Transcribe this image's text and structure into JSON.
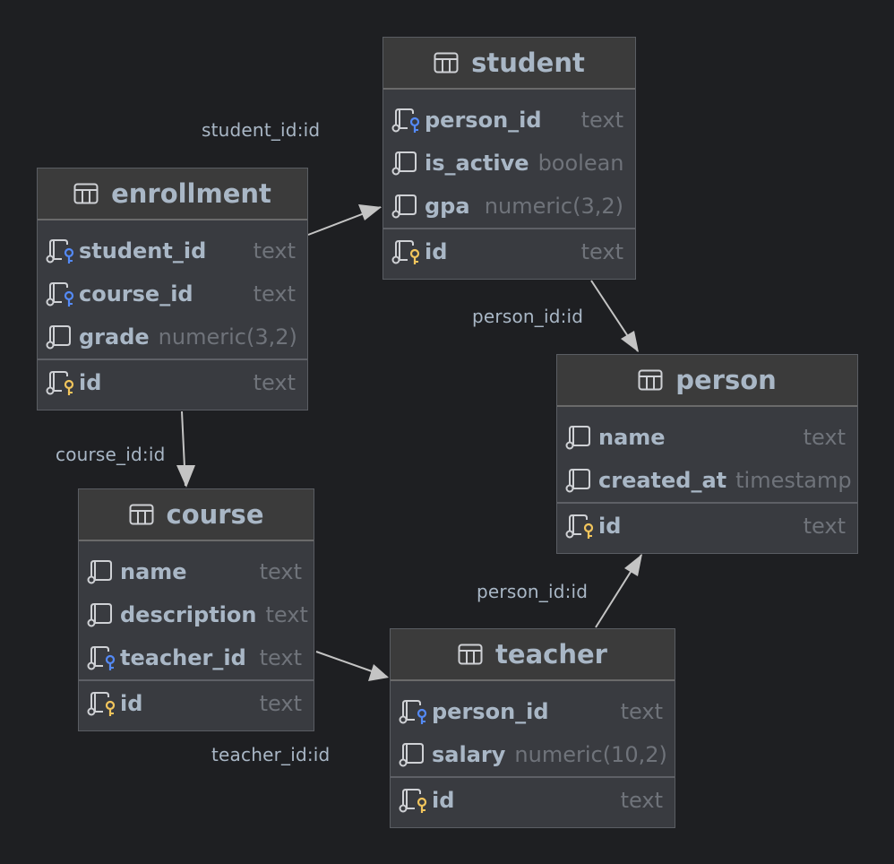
{
  "diagram": {
    "type": "database-er-diagram",
    "colors": {
      "background": "#1e1f22",
      "table_body": "#393b40",
      "table_header": "#3b3b3b",
      "column_name": "#a9b7c6",
      "column_type": "#6f737a",
      "foreign_key": "#548af7",
      "primary_key": "#f2c55c",
      "edge": "#c4c4c4"
    },
    "tables": {
      "student": {
        "name": "student",
        "columns": [
          {
            "name": "person_id",
            "type": "text",
            "key": "foreign"
          },
          {
            "name": "is_active",
            "type": "boolean",
            "key": "none"
          },
          {
            "name": "gpa",
            "type": "numeric(3,2)",
            "key": "none"
          }
        ],
        "primary": [
          {
            "name": "id",
            "type": "text",
            "key": "primary"
          }
        ]
      },
      "enrollment": {
        "name": "enrollment",
        "columns": [
          {
            "name": "student_id",
            "type": "text",
            "key": "foreign"
          },
          {
            "name": "course_id",
            "type": "text",
            "key": "foreign"
          },
          {
            "name": "grade",
            "type": "numeric(3,2)",
            "key": "none"
          }
        ],
        "primary": [
          {
            "name": "id",
            "type": "text",
            "key": "primary"
          }
        ]
      },
      "person": {
        "name": "person",
        "columns": [
          {
            "name": "name",
            "type": "text",
            "key": "none"
          },
          {
            "name": "created_at",
            "type": "timestamp",
            "key": "none"
          }
        ],
        "primary": [
          {
            "name": "id",
            "type": "text",
            "key": "primary"
          }
        ]
      },
      "course": {
        "name": "course",
        "columns": [
          {
            "name": "name",
            "type": "text",
            "key": "none"
          },
          {
            "name": "description",
            "type": "text",
            "key": "none"
          },
          {
            "name": "teacher_id",
            "type": "text",
            "key": "foreign"
          }
        ],
        "primary": [
          {
            "name": "id",
            "type": "text",
            "key": "primary"
          }
        ]
      },
      "teacher": {
        "name": "teacher",
        "columns": [
          {
            "name": "person_id",
            "type": "text",
            "key": "foreign"
          },
          {
            "name": "salary",
            "type": "numeric(10,2)",
            "key": "none"
          }
        ],
        "primary": [
          {
            "name": "id",
            "type": "text",
            "key": "primary"
          }
        ]
      }
    },
    "relations": [
      {
        "from": "enrollment",
        "to": "student",
        "label": "student_id:id"
      },
      {
        "from": "student",
        "to": "person",
        "label": "person_id:id"
      },
      {
        "from": "enrollment",
        "to": "course",
        "label": "course_id:id"
      },
      {
        "from": "course",
        "to": "teacher",
        "label": "teacher_id:id"
      },
      {
        "from": "teacher",
        "to": "person",
        "label": "person_id:id"
      }
    ]
  }
}
